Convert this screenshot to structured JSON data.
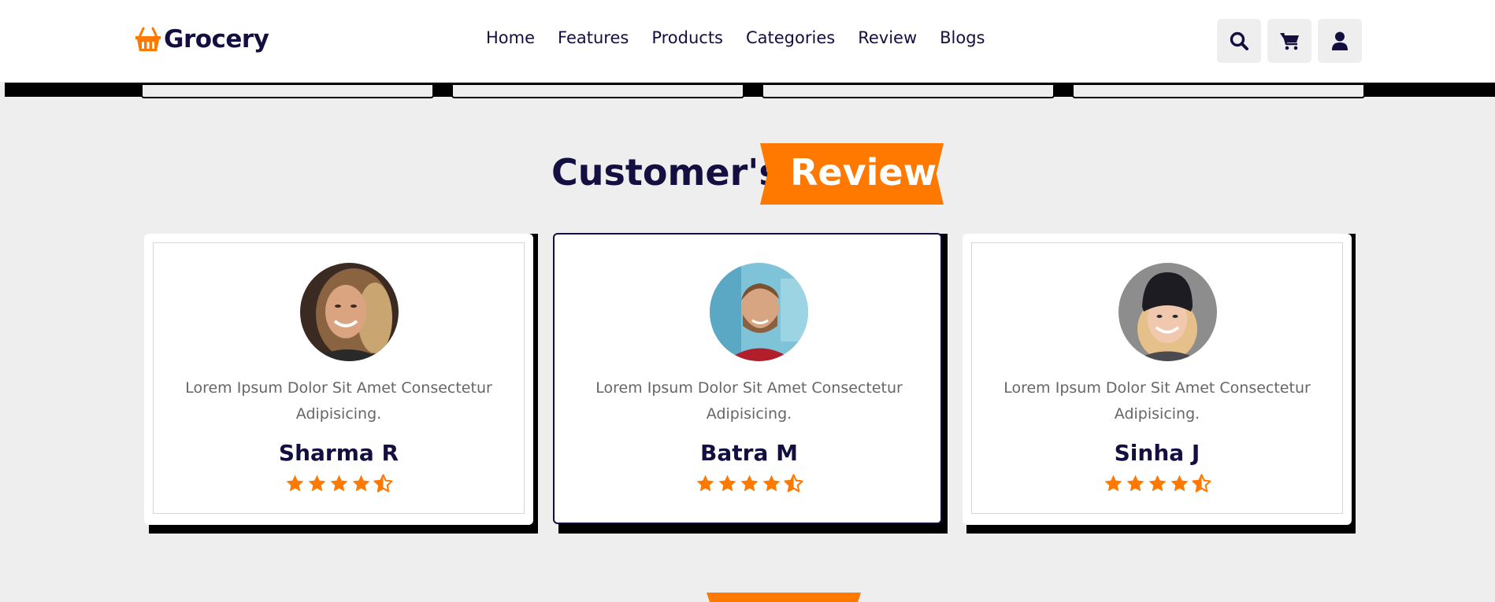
{
  "brand": {
    "name": "Grocery",
    "icon": "basket-icon",
    "accent": "#ff7800",
    "text_color": "#130f40"
  },
  "nav": {
    "items": [
      "Home",
      "Features",
      "Products",
      "Categories",
      "Review",
      "Blogs"
    ]
  },
  "header_icons": [
    "search-icon",
    "cart-icon",
    "user-icon"
  ],
  "section": {
    "title_left": "Customer's",
    "title_right": "Review"
  },
  "reviews": [
    {
      "text": "Lorem Ipsum Dolor Sit Amet Consectetur Adipisicing.",
      "name": "Sharma R",
      "rating": 4.5
    },
    {
      "text": "Lorem Ipsum Dolor Sit Amet Consectetur Adipisicing.",
      "name": "Batra M",
      "rating": 4.5
    },
    {
      "text": "Lorem Ipsum Dolor Sit Amet Consectetur Adipisicing.",
      "name": "Sinha J",
      "rating": 4.5
    }
  ]
}
